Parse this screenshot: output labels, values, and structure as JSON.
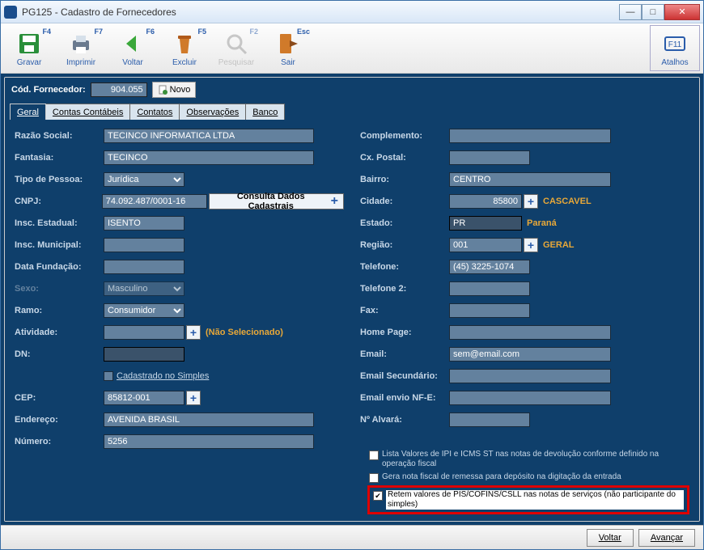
{
  "window": {
    "title": "PG125 - Cadastro de Fornecedores"
  },
  "toolbar": {
    "gravar": {
      "label": "Gravar",
      "key": "F4"
    },
    "imprimir": {
      "label": "Imprimir",
      "key": "F7"
    },
    "voltar": {
      "label": "Voltar",
      "key": "F6"
    },
    "excluir": {
      "label": "Excluir",
      "key": "F5"
    },
    "pesquisar": {
      "label": "Pesquisar",
      "key": "F2"
    },
    "sair": {
      "label": "Sair",
      "key": "Esc"
    },
    "atalhos": {
      "label": "Atalhos",
      "key": "F11"
    }
  },
  "code_row": {
    "label": "Cód. Fornecedor:",
    "value": "904.055",
    "novo": "Novo"
  },
  "tabs": {
    "geral": "Geral",
    "contas": "Contas Contábeis",
    "contatos": "Contatos",
    "obs": "Observações",
    "banco": "Banco"
  },
  "form": {
    "left": {
      "razao": {
        "label": "Razão Social:",
        "value": "TECINCO INFORMATICA LTDA"
      },
      "fantasia": {
        "label": "Fantasia:",
        "value": "TECINCO"
      },
      "tipo": {
        "label": "Tipo de Pessoa:",
        "value": "Jurídica"
      },
      "cnpj": {
        "label": "CNPJ:",
        "value": "74.092.487/0001-16",
        "consulta": "Consulta Dados Cadastrais"
      },
      "insc_est": {
        "label": "Insc. Estadual:",
        "value": "ISENTO"
      },
      "insc_mun": {
        "label": "Insc. Municipal:",
        "value": ""
      },
      "data_fund": {
        "label": "Data Fundação:",
        "value": ""
      },
      "sexo": {
        "label": "Sexo:",
        "value": "Masculino"
      },
      "ramo": {
        "label": "Ramo:",
        "value": "Consumidor"
      },
      "atividade": {
        "label": "Atividade:",
        "value": "",
        "nao_sel": "(Não Selecionado)"
      },
      "dn": {
        "label": "DN:",
        "value": ""
      },
      "cad_simples": {
        "label": "Cadastrado no Simples"
      },
      "cep": {
        "label": "CEP:",
        "value": "85812-001"
      },
      "endereco": {
        "label": "Endereço:",
        "value": "AVENIDA BRASIL"
      },
      "numero": {
        "label": "Número:",
        "value": "5256"
      }
    },
    "right": {
      "complemento": {
        "label": "Complemento:",
        "value": ""
      },
      "cx_postal": {
        "label": "Cx. Postal:",
        "value": ""
      },
      "bairro": {
        "label": "Bairro:",
        "value": "CENTRO"
      },
      "cidade": {
        "label": "Cidade:",
        "value": "85800",
        "after": "CASCAVEL"
      },
      "estado": {
        "label": "Estado:",
        "value": "PR",
        "after": "Paraná"
      },
      "regiao": {
        "label": "Região:",
        "value": "001",
        "after": "GERAL"
      },
      "telefone": {
        "label": "Telefone:",
        "value": "(45) 3225-1074"
      },
      "telefone2": {
        "label": "Telefone 2:",
        "value": ""
      },
      "fax": {
        "label": "Fax:",
        "value": ""
      },
      "homepage": {
        "label": "Home Page:",
        "value": ""
      },
      "email": {
        "label": "Email:",
        "value": "sem@email.com"
      },
      "email_sec": {
        "label": "Email Secundário:",
        "value": ""
      },
      "email_nfe": {
        "label": "Email envio NF-E:",
        "value": ""
      },
      "alvara": {
        "label": "Nº Alvará:",
        "value": ""
      }
    }
  },
  "options": {
    "opt1": "Lista Valores de IPI e ICMS ST nas notas de devolução conforme definido na operação fiscal",
    "opt2": "Gera nota fiscal de remessa para depósito na digitação da entrada",
    "opt3": "Retem valores de PIS/COFINS/CSLL nas notas de serviços (não participante do simples)"
  },
  "footer": {
    "voltar": "Voltar",
    "avancar": "Avançar"
  }
}
